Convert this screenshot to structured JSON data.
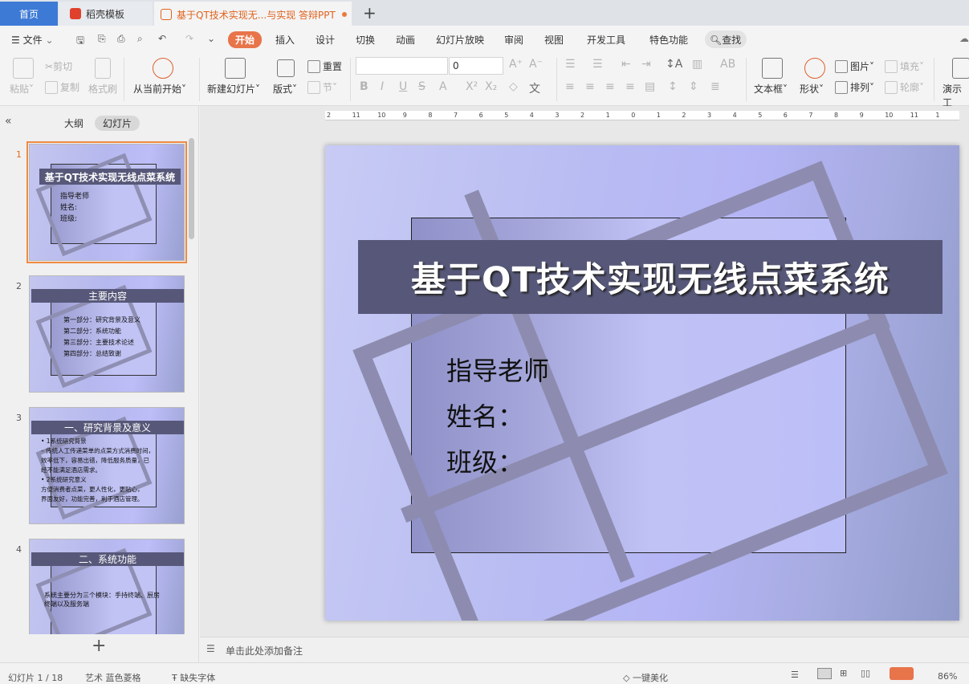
{
  "tabs": {
    "home": "首页",
    "template": "稻壳模板",
    "document": "基于QT技术实现无...与实现 答辩PPT"
  },
  "menu": {
    "file": "文件",
    "items": [
      "开始",
      "插入",
      "设计",
      "切换",
      "动画",
      "幻灯片放映",
      "审阅",
      "视图",
      "开发工具",
      "特色功能"
    ],
    "search": "查找"
  },
  "ribbon": {
    "paste": "粘贴",
    "cut": "剪切",
    "copy": "复制",
    "format_painter": "格式刷",
    "from_current": "从当前开始",
    "new_slide": "新建幻灯片",
    "layout": "版式",
    "reset": "重置",
    "section": "节",
    "font_size": "0",
    "text_box": "文本框",
    "shape": "形状",
    "picture": "图片",
    "arrange": "排列",
    "fill": "填充",
    "outline": "轮廓",
    "presentation_tool": "演示工"
  },
  "panel": {
    "outline_tab": "大纲",
    "slides_tab": "幻灯片"
  },
  "thumbnails": [
    {
      "num": "1",
      "title": "基于QT技术实现无线点菜系统",
      "lines": [
        "指导老师",
        "姓名:",
        "班级:"
      ]
    },
    {
      "num": "2",
      "title": "主要内容",
      "lines": [
        "第一部分：研究背景及意义",
        "第二部分：系统功能",
        "第三部分：主要技术论述",
        "第四部分：总结致谢"
      ]
    },
    {
      "num": "3",
      "title": "一、研究背景及意义",
      "lines": [
        "• 1系统研究背景",
        "  – 传统人工传递菜单的点菜方式消费时间，",
        "    效率低下，容易出错，降低服务质量，已",
        "    经不能满足酒店需求。",
        "• 2系统研究意义",
        "  方便消费者点菜，更人性化，更贴心，",
        "  界面友好，功能完善，利于酒店管理。"
      ]
    },
    {
      "num": "4",
      "title": "二、系统功能",
      "lines": [
        "系统主要分为三个模块：手持终端、厨房",
        "终端以及服务端"
      ]
    }
  ],
  "slide": {
    "title": "基于QT技术实现无线点菜系统",
    "body": [
      "指导老师",
      "姓名：",
      "班级："
    ]
  },
  "ruler": [
    "2",
    "11",
    "10",
    "9",
    "8",
    "7",
    "6",
    "5",
    "4",
    "3",
    "2",
    "1",
    "0",
    "1",
    "2",
    "3",
    "4",
    "5",
    "6",
    "7",
    "8",
    "9",
    "10",
    "11",
    "1"
  ],
  "notes": {
    "placeholder": "单击此处添加备注"
  },
  "status": {
    "slide_count": "幻灯片 1 / 18",
    "theme": "艺术 蓝色菱格",
    "missing_font": "缺失字体",
    "beautify": "一键美化",
    "zoom": "86%"
  },
  "colors": {
    "accent": "#e8744a",
    "home_tab": "#3d7ad6",
    "title_bar": "#575879"
  }
}
